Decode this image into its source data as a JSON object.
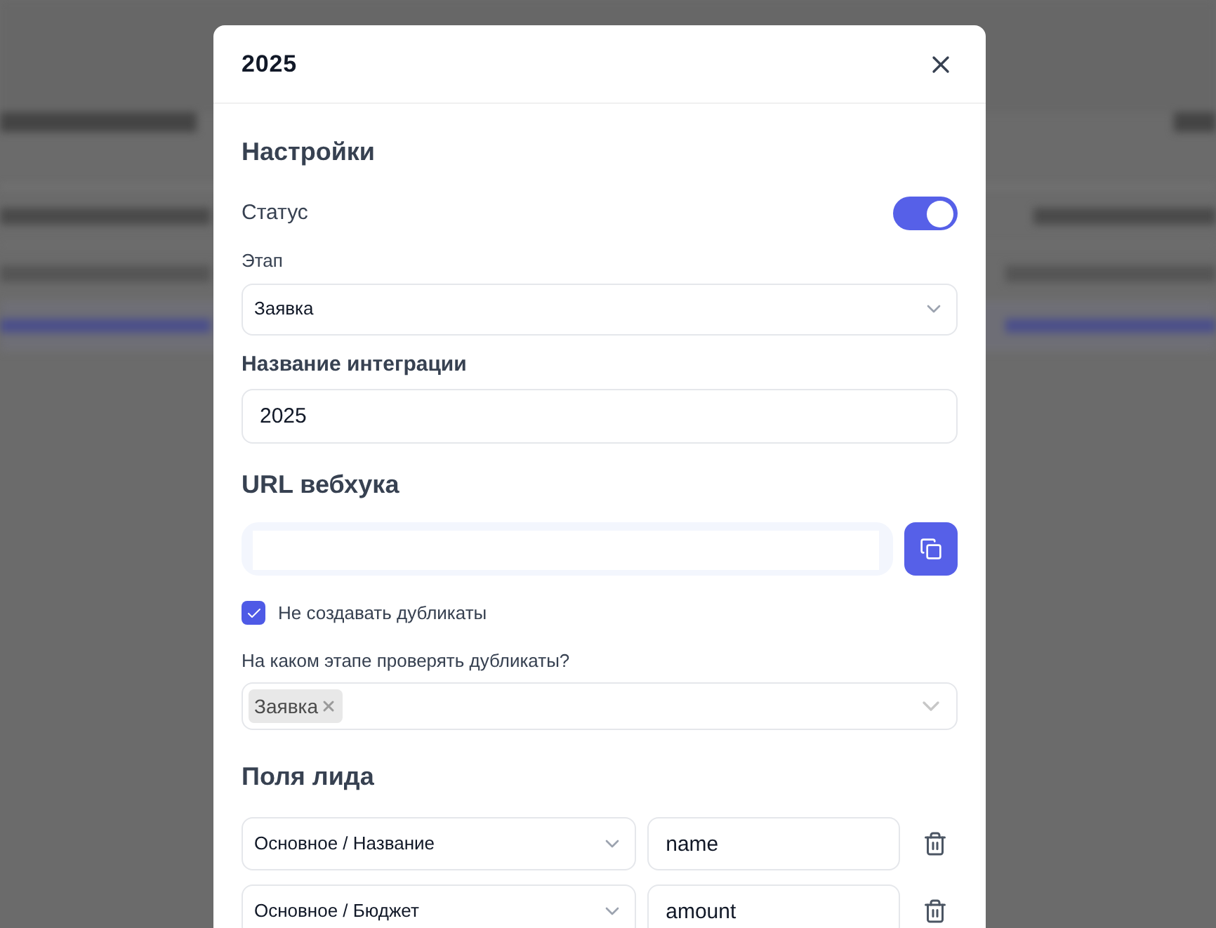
{
  "dialog": {
    "title": "2025"
  },
  "settings": {
    "heading": "Настройки",
    "status": {
      "label": "Статус",
      "on": true
    },
    "stage": {
      "label": "Этап",
      "value": "Заявка"
    },
    "integration_name": {
      "label": "Название интеграции",
      "value": "2025"
    }
  },
  "webhook": {
    "heading": "URL вебхука"
  },
  "no_duplicates": {
    "label": "Не создавать дубликаты",
    "checked": true
  },
  "duplicate_stage": {
    "label": "На каком этапе проверять дубликаты?",
    "tags": [
      "Заявка"
    ]
  },
  "lead_fields": {
    "heading": "Поля лида",
    "rows": [
      {
        "field": "Основное / Название",
        "key": "name"
      },
      {
        "field": "Основное / Бюджет",
        "key": "amount"
      }
    ]
  }
}
